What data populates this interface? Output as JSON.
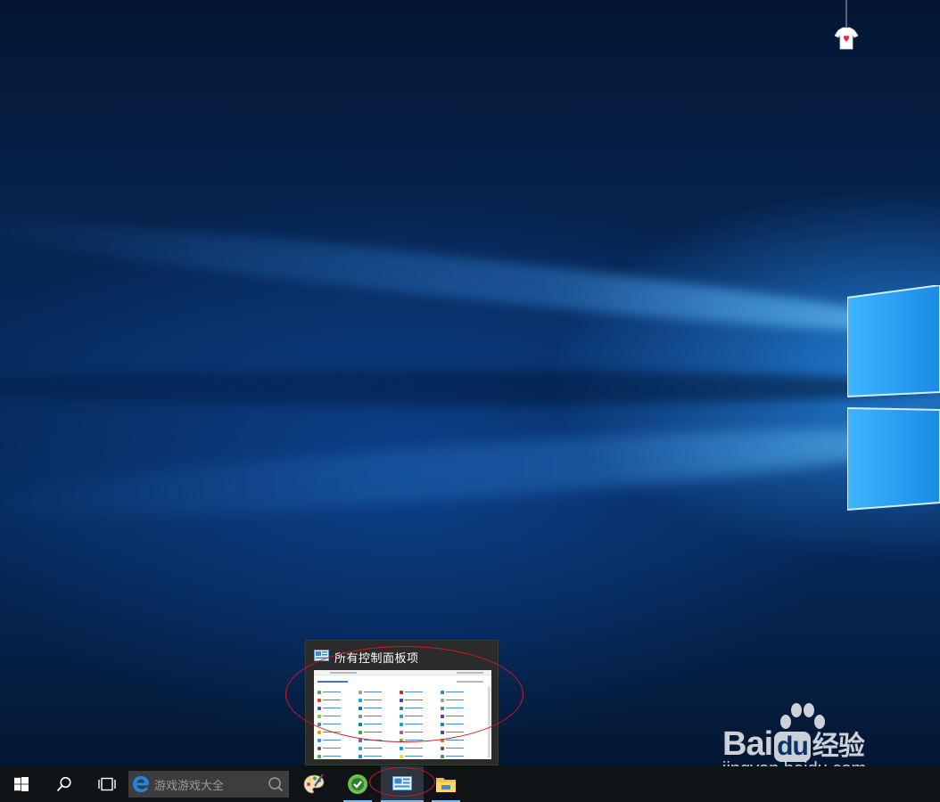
{
  "taskbar": {
    "search_placeholder": "游戏游戏大全",
    "pinned_apps": [
      "drawing-app",
      "green-round-app",
      "control-panel",
      "file-explorer"
    ]
  },
  "preview": {
    "window_title": "所有控制面板项"
  },
  "watermark": {
    "brand_left": "Bai",
    "brand_du": "du",
    "brand_right": "经验",
    "url": "jingyan.baidu.com"
  },
  "colors": {
    "taskbar": "#101316",
    "annotation": "#d11a1a",
    "accent": "#76b9ed"
  }
}
